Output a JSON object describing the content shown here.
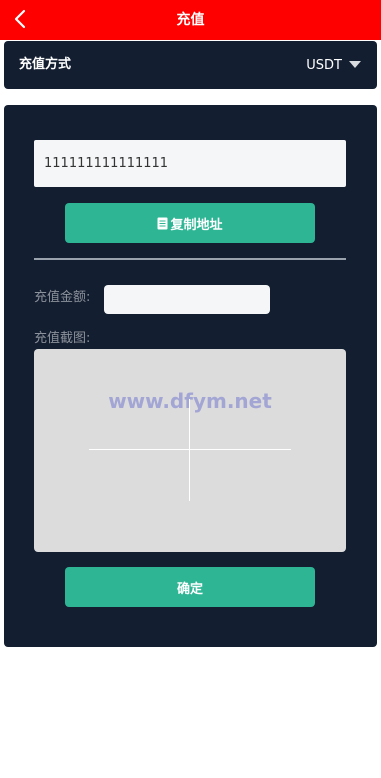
{
  "header": {
    "title": "充值",
    "background_color": "#ff0000",
    "back_icon": "chevron-left-icon"
  },
  "recharge_method": {
    "label": "充值方式",
    "selected_value": "USDT",
    "dropdown_icon": "caret-down-icon"
  },
  "wallet": {
    "address": "111111111111111",
    "copy_icon": "document-icon",
    "copy_button_label": "复制地址"
  },
  "amount": {
    "label": "充值金额:",
    "value": ""
  },
  "screenshot": {
    "label": "充值截图:",
    "upload_icon": "plus-icon",
    "watermark": "www.dfym.net"
  },
  "confirm_button_label": "确定",
  "colors": {
    "panel": "#131e30",
    "accent": "#2db594",
    "input_bg": "#f4f6f8",
    "upload_bg": "#dcdcdc"
  }
}
